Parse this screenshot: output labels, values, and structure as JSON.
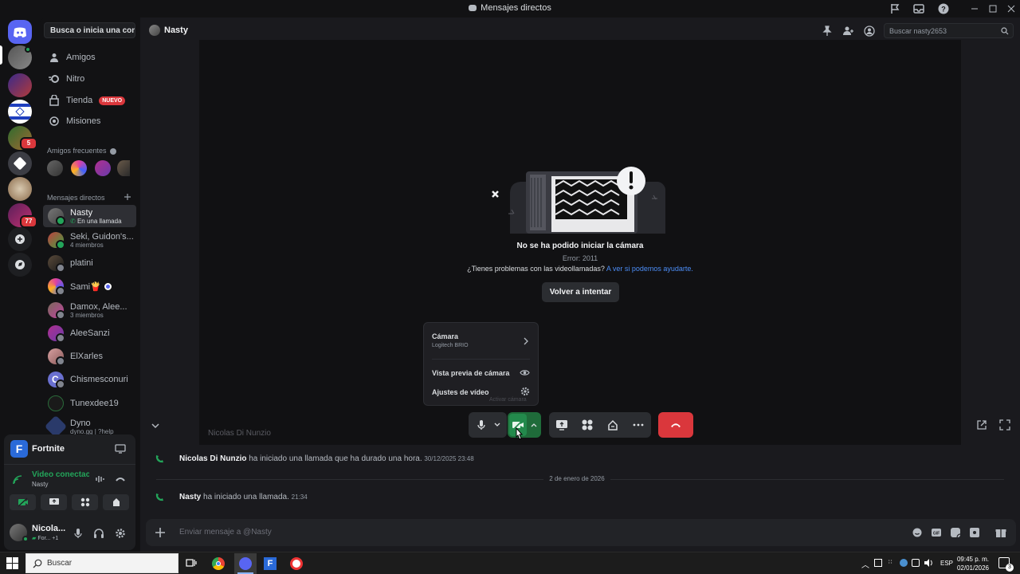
{
  "window": {
    "title": "Mensajes directos"
  },
  "servers": {
    "badges": [
      "5",
      "77"
    ]
  },
  "sidebar": {
    "search_label": "Busca o inicia una conv...",
    "nav": [
      {
        "label": "Amigos",
        "icon": "friends-icon"
      },
      {
        "label": "Nitro",
        "icon": "nitro-icon"
      },
      {
        "label": "Tienda",
        "icon": "shop-icon",
        "badge": "NUEVO"
      },
      {
        "label": "Misiones",
        "icon": "quests-icon"
      }
    ],
    "frequent_label": "Amigos frecuentes",
    "dm_label": "Mensajes directos",
    "dms": [
      {
        "name": "Nasty",
        "sub": "En una llamada"
      },
      {
        "name": "Seki, Guidon's...",
        "sub": "4 miembros"
      },
      {
        "name": "platini",
        "sub": ""
      },
      {
        "name": "Sami🍟",
        "sub": ""
      },
      {
        "name": "Damox, Alee...",
        "sub": "3 miembros"
      },
      {
        "name": "AleeSanzi",
        "sub": ""
      },
      {
        "name": "ElXarles",
        "sub": ""
      },
      {
        "name": "Chismesconuri",
        "sub": ""
      },
      {
        "name": "Tunexdee19",
        "sub": ""
      },
      {
        "name": "Dyno",
        "sub": "dyno.gg | ?help"
      }
    ]
  },
  "activity": {
    "game": "Fortnite",
    "voice_status": "Video conectac",
    "voice_channel": "Nasty",
    "user_name": "Nicola...",
    "user_status": "For... +1"
  },
  "header": {
    "channel_name": "Nasty",
    "search_placeholder": "Buscar nasty2653"
  },
  "call": {
    "error_title": "No se ha podido iniciar la cámara",
    "error_code": "Error: 2011",
    "help_text": "¿Tienes problemas con las videollamadas?",
    "help_link": "A ver si podemos ayudarte.",
    "retry_label": "Volver a intentar",
    "participant_name": "Nicolas Di Nunzio",
    "tooltip_hint": "Activar cámara"
  },
  "camera_menu": {
    "camera_label": "Cámara",
    "camera_device": "Logitech BRIO",
    "preview_label": "Vista previa de cámara",
    "settings_label": "Ajustes de vídeo"
  },
  "messages": [
    {
      "author": "Nicolas Di Nunzio",
      "text": "ha iniciado una llamada que ha durado una hora.",
      "time": "30/12/2025 23:48"
    },
    {
      "divider": "2 de enero de 2026"
    },
    {
      "author": "Nasty",
      "text": "ha iniciado una llamada.",
      "time": "21:34"
    }
  ],
  "composer": {
    "placeholder": "Enviar mensaje a @Nasty"
  },
  "taskbar": {
    "search_placeholder": "Buscar",
    "lang": "ESP",
    "time": "09:45 p. m.",
    "date": "02/01/2026",
    "notif_count": "3"
  },
  "colors": {
    "accent": "#5865f2",
    "green": "#23a55a",
    "danger": "#da373c",
    "link": "#4c8df6"
  }
}
